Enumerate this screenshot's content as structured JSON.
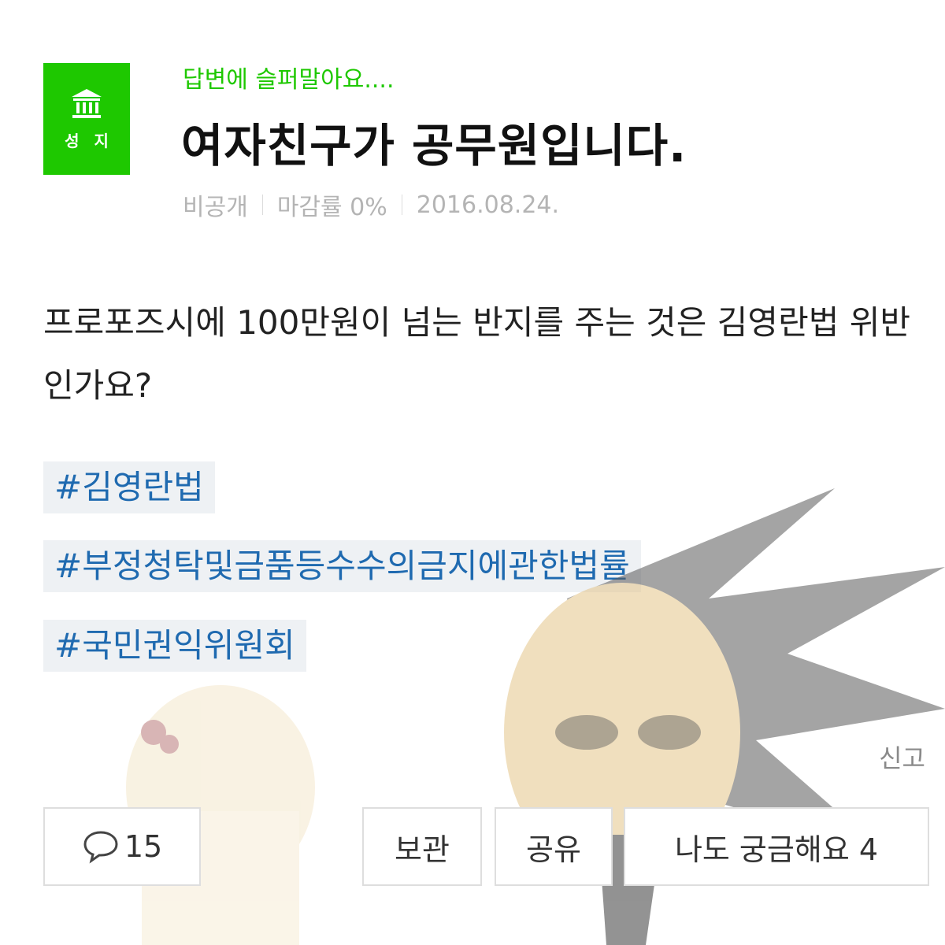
{
  "header": {
    "badge_label": "성 지",
    "category": "답변에 슬퍼말아요....",
    "title": "여자친구가 공무원입니다."
  },
  "meta": {
    "visibility": "비공개",
    "deadline": "마감률 0%",
    "date": "2016.08.24."
  },
  "question": "프로포즈시에 100만원이 넘는 반지를 주는 것은 김영란법 위반인가요?",
  "tags": [
    "#김영란법",
    "#부정청탁및금품등수수의금지에관한법률",
    "#국민권익위원회"
  ],
  "report_label": "신고",
  "actions": {
    "comment_count": "15",
    "save_label": "보관",
    "share_label": "공유",
    "curious_label": "나도 궁금해요 4"
  },
  "icons": {
    "badge": "landmark-icon",
    "comment": "speech-bubble-icon"
  },
  "colors": {
    "brand_green": "#1ec800",
    "tag_blue": "#1f6ab0",
    "tag_bg": "#eef1f4"
  }
}
